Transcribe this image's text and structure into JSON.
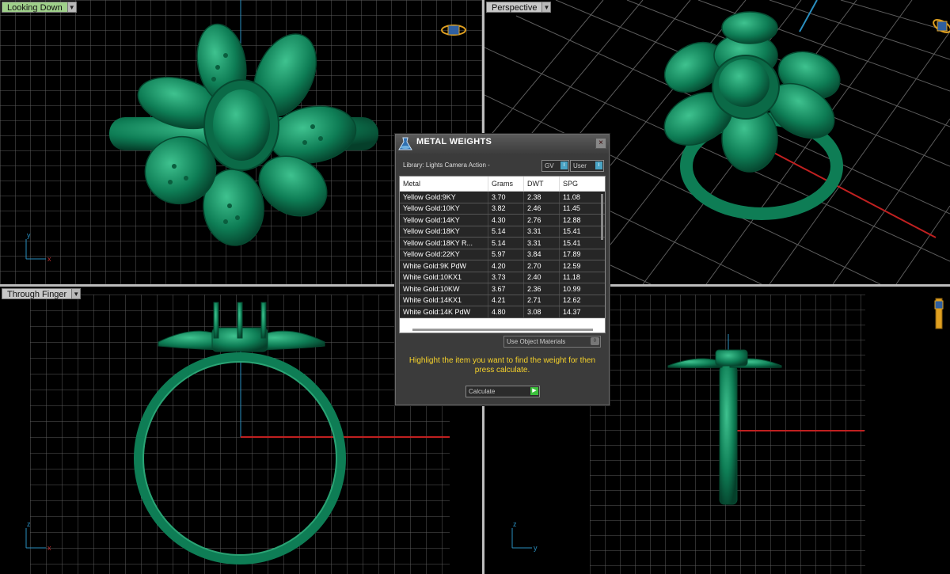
{
  "viewports": {
    "top_left": {
      "label": "Looking Down"
    },
    "top_right": {
      "label": "Perspective"
    },
    "bottom_left": {
      "label": "Through Finger"
    },
    "bottom_right": {
      "label": ""
    }
  },
  "axes": {
    "x": "x",
    "y": "y",
    "z": "z"
  },
  "panel": {
    "title": "METAL WEIGHTS",
    "library_label": "Library: Lights Camera Action -",
    "gv_label": "GV",
    "user_label": "User",
    "columns": [
      "Metal",
      "Grams",
      "DWT",
      "SPG"
    ],
    "rows": [
      [
        "Yellow Gold:9KY",
        "3.70",
        "2.38",
        "11.08"
      ],
      [
        "Yellow Gold:10KY",
        "3.82",
        "2.46",
        "11.45"
      ],
      [
        "Yellow Gold:14KY",
        "4.30",
        "2.76",
        "12.88"
      ],
      [
        "Yellow Gold:18KY",
        "5.14",
        "3.31",
        "15.41"
      ],
      [
        "Yellow Gold:18KY R...",
        "5.14",
        "3.31",
        "15.41"
      ],
      [
        "Yellow Gold:22KY",
        "5.97",
        "3.84",
        "17.89"
      ],
      [
        "White Gold:9K PdW",
        "4.20",
        "2.70",
        "12.59"
      ],
      [
        "White Gold:10KX1",
        "3.73",
        "2.40",
        "11.18"
      ],
      [
        "White Gold:10KW",
        "3.67",
        "2.36",
        "10.99"
      ],
      [
        "White Gold:14KX1",
        "4.21",
        "2.71",
        "12.62"
      ],
      [
        "White Gold:14K PdW",
        "4.80",
        "3.08",
        "14.37"
      ]
    ],
    "use_object_materials": "Use Object Materials",
    "hint": "Highlight the item you want to find the weight for then press calculate.",
    "calculate_label": "Calculate"
  },
  "colors": {
    "model": "#0d7d55",
    "grid": "#5c5c5c",
    "accent_label": "#9fd08a",
    "hint": "#f6d22a"
  }
}
